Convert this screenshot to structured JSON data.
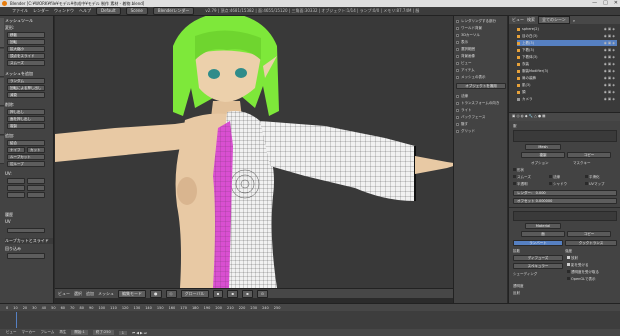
{
  "window": {
    "title": "Blender [C:¥WORK¥file¥モデル¥作成中¥モデル 制作 素材 - 着物.blend]",
    "buttons": [
      "—",
      "□",
      "✕"
    ]
  },
  "menubar": {
    "items": [
      "ファイル",
      "レンダー",
      "ウィンドウ",
      "ヘルプ"
    ],
    "layout": "Default",
    "scene": "Scene",
    "engine": "Blenderレンダー",
    "stats": "v2.79 | 頂点:4681/15382 | 面:4655/15120 | 三角面:30332 | オブジェクト:1/14 | ランプ:0/0 | メモリ:87.74M | 服"
  },
  "toolshelf": {
    "tabs": [
      "ツール",
      "作成",
      "シェーディング",
      "オプション",
      "グリース"
    ],
    "sections": [
      "メッシュツール",
      "変形:",
      "メッシュを追加",
      "削除:",
      "追加:",
      "UV:"
    ],
    "buttons": [
      "移動",
      "回転",
      "拡大縮小",
      "頂点をスライド",
      "スムーズ",
      "ランダム",
      "回転による押し出し",
      "減衰",
      "押し出し",
      "面を押し出し",
      "複製",
      "結合",
      "ナイフ",
      "カット",
      "ループカット",
      "辺ループ"
    ],
    "bottom": {
      "label1": "履歴",
      "label2": "UV",
      "panel": "ループカットとスライド",
      "field": "回り込み"
    }
  },
  "npanel": {
    "items": [
      "レンダリングする部分",
      "ワールド背景",
      "3Dカーソル",
      "表示",
      "選択範囲",
      "背景画像",
      "ビュー",
      "アイテム",
      "メッシュの表示",
      "法線",
      "トランスフォームの向き",
      "ライト",
      "バックフェース",
      "隠す",
      "グリッド"
    ],
    "selected": "オブジェクトを適用"
  },
  "outliner": {
    "header": {
      "view": "ビュー",
      "search": "検索",
      "mode": "全てのシーン"
    },
    "items": [
      {
        "name": "sphere(2)"
      },
      {
        "name": "目の白(3)"
      },
      {
        "name": "上着(3)"
      },
      {
        "name": "下着(3)"
      },
      {
        "name": "下着体(3)"
      },
      {
        "name": "衣装"
      },
      {
        "name": "服装Modifier(3)"
      },
      {
        "name": "肩の装飾"
      },
      {
        "name": "肌(3)"
      },
      {
        "name": "頭"
      },
      {
        "name": "カメラ"
      }
    ]
  },
  "props": {
    "header": "服",
    "mesh_label": "頂点グループ",
    "mesh": "Mesh",
    "mat_btn1": "複製",
    "mat_btn2": "コピー",
    "options": [
      "オプション",
      "マスクキー",
      "形状",
      "スムーズ",
      "半透明",
      "法線",
      "シャドウ",
      "平滑化",
      "UVマップ"
    ],
    "number_label": "レンダー：",
    "number_val": "0.000",
    "numfield2_label": "オフセット",
    "numfield2_val": "0.000000",
    "mat2": "Material",
    "surface_btn1": "面",
    "surface_btn2": "コピー",
    "shading": "ランバート",
    "shading2": "クックトランス",
    "sub": [
      "拡散",
      "強度",
      "ディフューズ",
      "スペキュラー",
      "シェーディング",
      "透明度",
      "反射"
    ],
    "checks": [
      "放射",
      "影を受ける",
      "透明度を受け取る",
      "OpenGLで表示"
    ]
  },
  "viewport_header": {
    "items": [
      "ビュー",
      "選択",
      "追加",
      "メッシュ",
      "編集モード",
      "グローバル"
    ],
    "mode": "編集モード"
  },
  "timeline": {
    "header": [
      "ビュー",
      "マーカー",
      "フレーム",
      "再生"
    ],
    "start_label": "開始:",
    "start": "1",
    "end_label": "終了:",
    "end": "250",
    "frame": "1",
    "ticks": [
      "0",
      "10",
      "20",
      "30",
      "40",
      "50",
      "60",
      "70",
      "80",
      "90",
      "100",
      "110",
      "120",
      "130",
      "140",
      "150",
      "160",
      "170",
      "180",
      "190",
      "200",
      "210",
      "220",
      "230",
      "240",
      "250"
    ]
  },
  "colors": {
    "hair": "#7ee83a",
    "skin": "#e8c9a4",
    "seam": "#d94fd1",
    "mesh_white": "#f1f1f1",
    "accent": "#5680c2",
    "orange": "#e7a23a"
  }
}
